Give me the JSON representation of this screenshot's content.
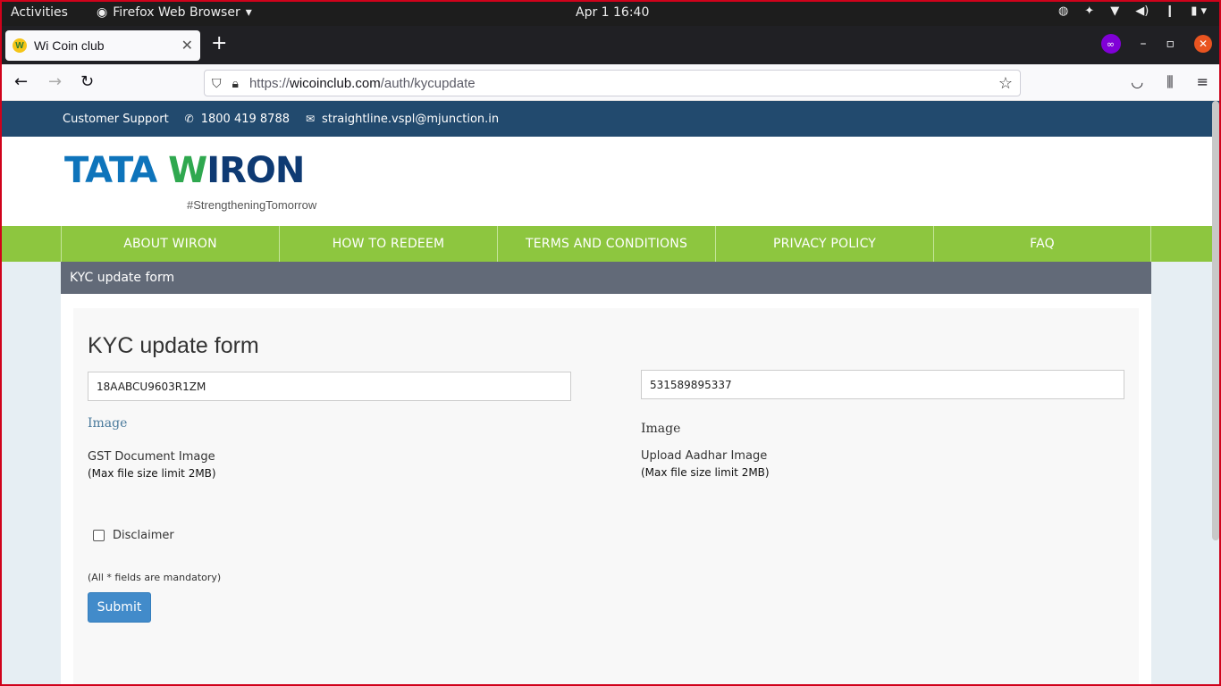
{
  "system": {
    "activities": "Activities",
    "app_name": "Firefox Web Browser",
    "clock": "Apr 1  16:40"
  },
  "browser": {
    "tab_title": "Wi Coin club",
    "url_scheme": "https://",
    "url_host": "wicoinclub.com",
    "url_path": "/auth/kycupdate"
  },
  "page": {
    "support": {
      "label": "Customer Support",
      "phone": "1800 419 8788",
      "email": "straightline.vspl@mjunction.in"
    },
    "logo": {
      "tata": "TATA",
      "w": "W",
      "iron": "IRON",
      "tagline": "#StrengtheningTomorrow"
    },
    "nav": [
      "ABOUT WIRON",
      "HOW TO REDEEM",
      "TERMS AND CONDITIONS",
      "PRIVACY POLICY",
      "FAQ"
    ],
    "breadcrumb": "KYC update form",
    "form": {
      "title": "KYC update form",
      "gst_value": "18AABCU9603R1ZM",
      "aadhar_value": "531589895337",
      "left_image_label": "Image",
      "right_image_label": "Image",
      "gst_doc_label": "GST Document Image",
      "aadhar_doc_label": "Upload Aadhar Image",
      "size_limit": "(Max file size limit 2MB)",
      "disclaimer": "Disclaimer",
      "mandatory": "(All * fields are mandatory)",
      "submit": "Submit"
    }
  },
  "colors": {
    "support_bar": "#224a6e",
    "nav_green": "#8dc63f",
    "crumb_bar": "#626a78",
    "submit_blue": "#428bca",
    "image_label_left": "#4a7a9c"
  }
}
